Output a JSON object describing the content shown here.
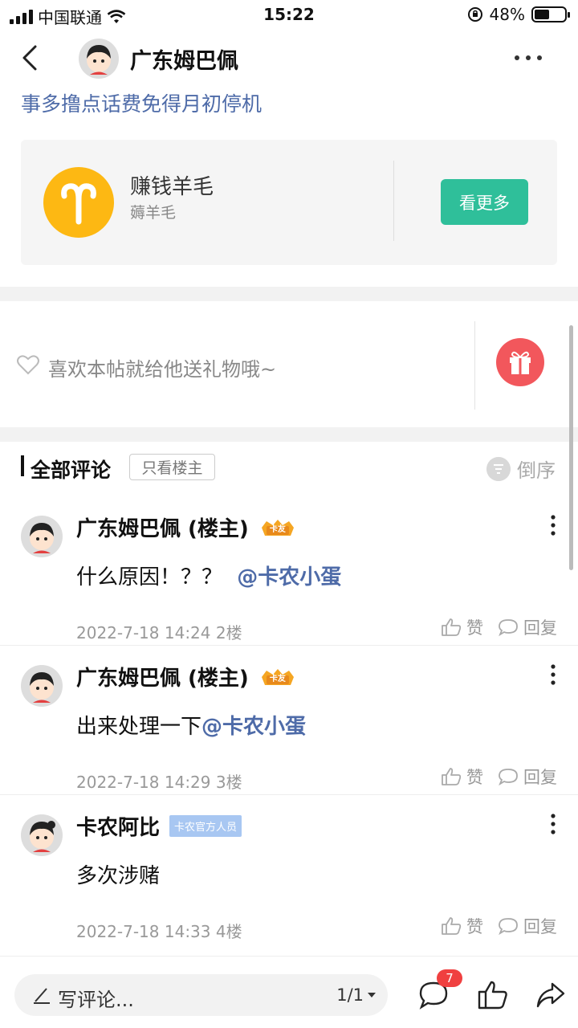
{
  "status_bar": {
    "carrier": "中国联通",
    "time": "15:22",
    "battery_percent": "48%",
    "battery_level": 0.48
  },
  "header": {
    "author_name": "广东姆巴佩"
  },
  "post": {
    "text": "事多撸点话费免得月初停机"
  },
  "group_card": {
    "title": "赚钱羊毛",
    "subtitle": "薅羊毛",
    "button_label": "看更多"
  },
  "gift": {
    "prompt": "喜欢本帖就给他送礼物哦~"
  },
  "comments_section": {
    "title": "全部评论",
    "only_op_label": "只看楼主",
    "sort_label": "倒序"
  },
  "comments": [
    {
      "name": "广东姆巴佩 (楼主)",
      "badge": "卡友",
      "text": "什么原因！？？",
      "mention": "@卡农小蛋",
      "meta": "2022-7-18 14:24  2楼",
      "like_label": "赞",
      "reply_label": "回复"
    },
    {
      "name": "广东姆巴佩 (楼主)",
      "badge": "卡友",
      "text": "出来处理一下",
      "mention": "@卡农小蛋",
      "meta": "2022-7-18 14:29  3楼",
      "like_label": "赞",
      "reply_label": "回复"
    },
    {
      "name": "卡农阿比",
      "badge": "卡农官方人员",
      "text": "多次涉赌",
      "mention": "",
      "meta": "2022-7-18 14:33  4楼",
      "like_label": "赞",
      "reply_label": "回复"
    }
  ],
  "bottom_bar": {
    "write_placeholder": "写评论...",
    "page_indicator": "1/1",
    "comment_count_badge": "7"
  },
  "colors": {
    "link": "#4e6ba8",
    "accent_green": "#2fbf9a",
    "gift_red": "#f2575c",
    "group_logo": "#fdb813"
  }
}
